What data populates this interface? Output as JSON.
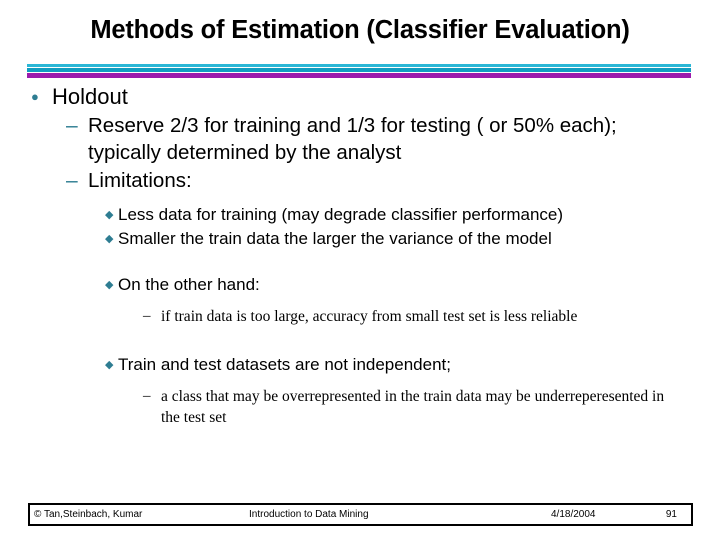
{
  "slide": {
    "title": "Methods of Estimation (Classifier Evaluation)",
    "accent_colors": {
      "cyan_thin": "#2bb7d6",
      "teal": "#119ec0",
      "purple": "#9c1bac",
      "bullet": "#2e7d92"
    },
    "markers": {
      "level1": "●",
      "level2": "–",
      "level3": "◆",
      "level4": "–"
    },
    "content": {
      "l1_holdout": "Holdout",
      "l2_reserve": "Reserve 2/3 for training and 1/3 for testing ( or 50% each); typically determined by the analyst",
      "l2_limitations": "Limitations:",
      "l3_less_data": "Less data for training (may degrade classifier performance)",
      "l3_smaller_train": "Smaller the train data the larger the variance of the model",
      "l3_on_the_other_hand": "On the other hand:",
      "l4_if_train_data": "if train data is too large, accuracy from small test set is less reliable",
      "l3_train_test_indep": "Train and test datasets are not independent;",
      "l4_a_class_that": " a class that may be overrepresented in the train data may be underreperesented in the test set"
    }
  },
  "footer": {
    "copyright": "© Tan,Steinbach, Kumar",
    "center": "Introduction to Data Mining",
    "date": "4/18/2004",
    "page": "91"
  }
}
